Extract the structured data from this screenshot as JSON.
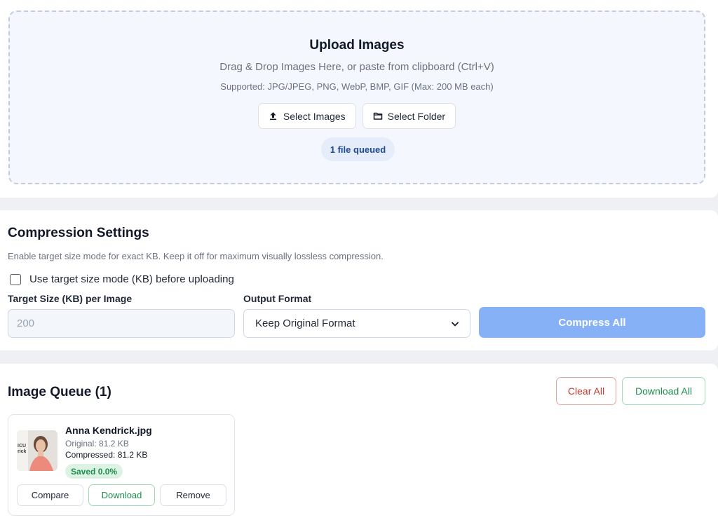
{
  "upload": {
    "title": "Upload Images",
    "subtitle": "Drag & Drop Images Here, or paste from clipboard (Ctrl+V)",
    "supported": "Supported: JPG/JPEG, PNG, WebP, BMP, GIF (Max: 200 MB each)",
    "select_images_label": "Select Images",
    "select_images_icon": "upload-icon",
    "select_folder_label": "Select Folder",
    "select_folder_icon": "folder-icon",
    "queued_text": "1 file queued"
  },
  "settings": {
    "title": "Compression Settings",
    "description": "Enable target size mode for exact KB. Keep it off for maximum visually lossless compression.",
    "target_mode_label": "Use target size mode (KB) before uploading",
    "target_mode_checked": false,
    "target_size_label": "Target Size (KB) per Image",
    "target_size_placeholder": "200",
    "output_format_label": "Output Format",
    "output_format_value": "Keep Original Format",
    "compress_all_label": "Compress All"
  },
  "queue": {
    "title": "Image Queue (1)",
    "clear_all_label": "Clear All",
    "download_all_label": "Download All",
    "items": [
      {
        "file_name": "Anna Kendrick.jpg",
        "original": "Original: 81.2 KB",
        "compressed": "Compressed: 81.2 KB",
        "saved": "Saved 0.0%",
        "thumb_text": "rick",
        "compare_label": "Compare",
        "download_label": "Download",
        "remove_label": "Remove"
      }
    ]
  },
  "colors": {
    "accent_blue": "#86b1f6",
    "success_green": "#1e8e4e",
    "danger_red": "#c0392b"
  }
}
